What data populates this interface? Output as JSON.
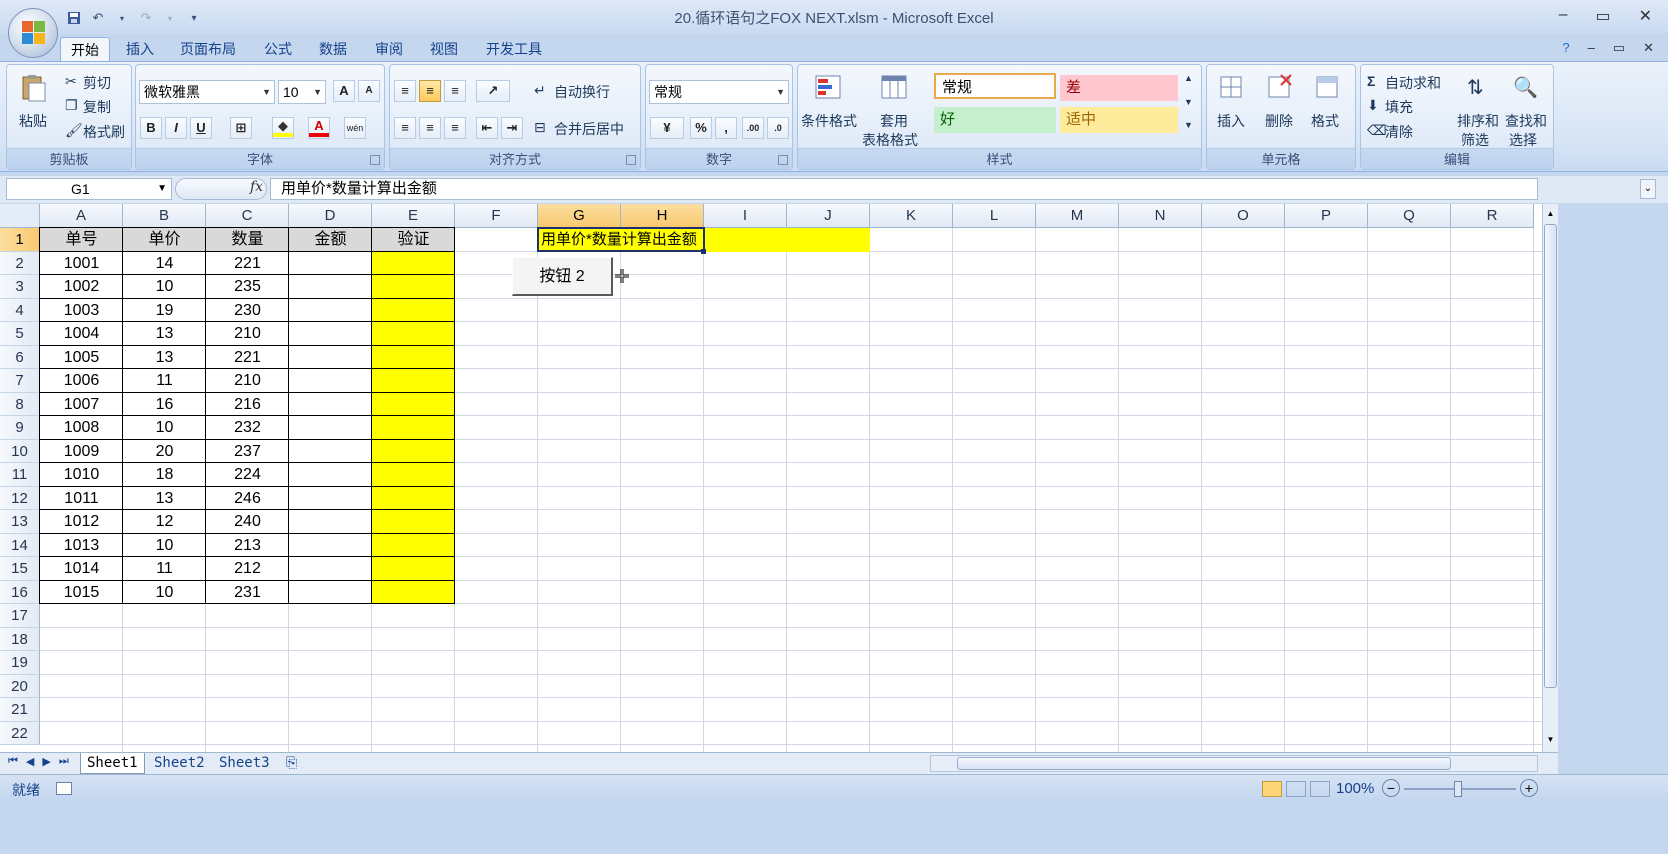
{
  "window": {
    "title": "20.循环语句之FOX NEXT.xlsm - Microsoft Excel",
    "minimize": "–",
    "restore": "▭",
    "close": "✕"
  },
  "tabs": [
    "开始",
    "插入",
    "页面布局",
    "公式",
    "数据",
    "审阅",
    "视图",
    "开发工具"
  ],
  "ribbon": {
    "clipboard": {
      "paste": "粘贴",
      "cut": "剪切",
      "copy": "复制",
      "format_painter": "格式刷",
      "label": "剪贴板"
    },
    "font": {
      "name": "微软雅黑",
      "size": "10",
      "label": "字体",
      "bold": "B",
      "italic": "I",
      "underline": "U",
      "grow": "A",
      "shrink": "A",
      "fontcolor": "A",
      "wen": "wén"
    },
    "alignment": {
      "wrap": "自动换行",
      "merge": "合并后居中",
      "label": "对齐方式"
    },
    "number": {
      "format": "常规",
      "label": "数字",
      "percent": "%",
      "comma": ","
    },
    "styles": {
      "conditional": "条件格式",
      "table_line1": "套用",
      "table_line2": "表格格式",
      "label": "样式",
      "normal": "常规",
      "bad": "差",
      "good": "好",
      "neutral": "适中"
    },
    "cells": {
      "insert": "插入",
      "delete": "删除",
      "format": "格式",
      "label": "单元格"
    },
    "editing": {
      "autosum": "自动求和",
      "fill": "填充",
      "clear": "清除",
      "sort_line1": "排序和",
      "sort_line2": "筛选",
      "find_line1": "查找和",
      "find_line2": "选择",
      "label": "编辑"
    }
  },
  "formula_bar": {
    "name_box": "G1",
    "fx": "fx",
    "content": "用单价*数量计算出金额"
  },
  "columns": [
    "A",
    "B",
    "C",
    "D",
    "E",
    "F",
    "G",
    "H",
    "I",
    "J",
    "K",
    "L",
    "M",
    "N",
    "O",
    "P",
    "Q",
    "R"
  ],
  "rows": [
    "1",
    "2",
    "3",
    "4",
    "5",
    "6",
    "7",
    "8",
    "9",
    "10",
    "11",
    "12",
    "13",
    "14",
    "15",
    "16",
    "17",
    "18",
    "19",
    "20",
    "21",
    "22"
  ],
  "table": {
    "headers": [
      "单号",
      "单价",
      "数量",
      "金额",
      "验证"
    ],
    "rows": [
      [
        "1001",
        "14",
        "221"
      ],
      [
        "1002",
        "10",
        "235"
      ],
      [
        "1003",
        "19",
        "230"
      ],
      [
        "1004",
        "13",
        "210"
      ],
      [
        "1005",
        "13",
        "221"
      ],
      [
        "1006",
        "11",
        "210"
      ],
      [
        "1007",
        "16",
        "216"
      ],
      [
        "1008",
        "10",
        "232"
      ],
      [
        "1009",
        "20",
        "237"
      ],
      [
        "1010",
        "18",
        "224"
      ],
      [
        "1011",
        "13",
        "246"
      ],
      [
        "1012",
        "12",
        "240"
      ],
      [
        "1013",
        "10",
        "213"
      ],
      [
        "1014",
        "11",
        "212"
      ],
      [
        "1015",
        "10",
        "231"
      ]
    ]
  },
  "note_cell": "用单价*数量计算出金额",
  "button2": "按钮 2",
  "sheets": [
    "Sheet1",
    "Sheet2",
    "Sheet3"
  ],
  "status": {
    "ready": "就绪",
    "zoom": "100%"
  },
  "colors": {
    "yellow": "#ffff00",
    "header_gray": "#d9d9d9",
    "selected_header": "#f8c870"
  }
}
